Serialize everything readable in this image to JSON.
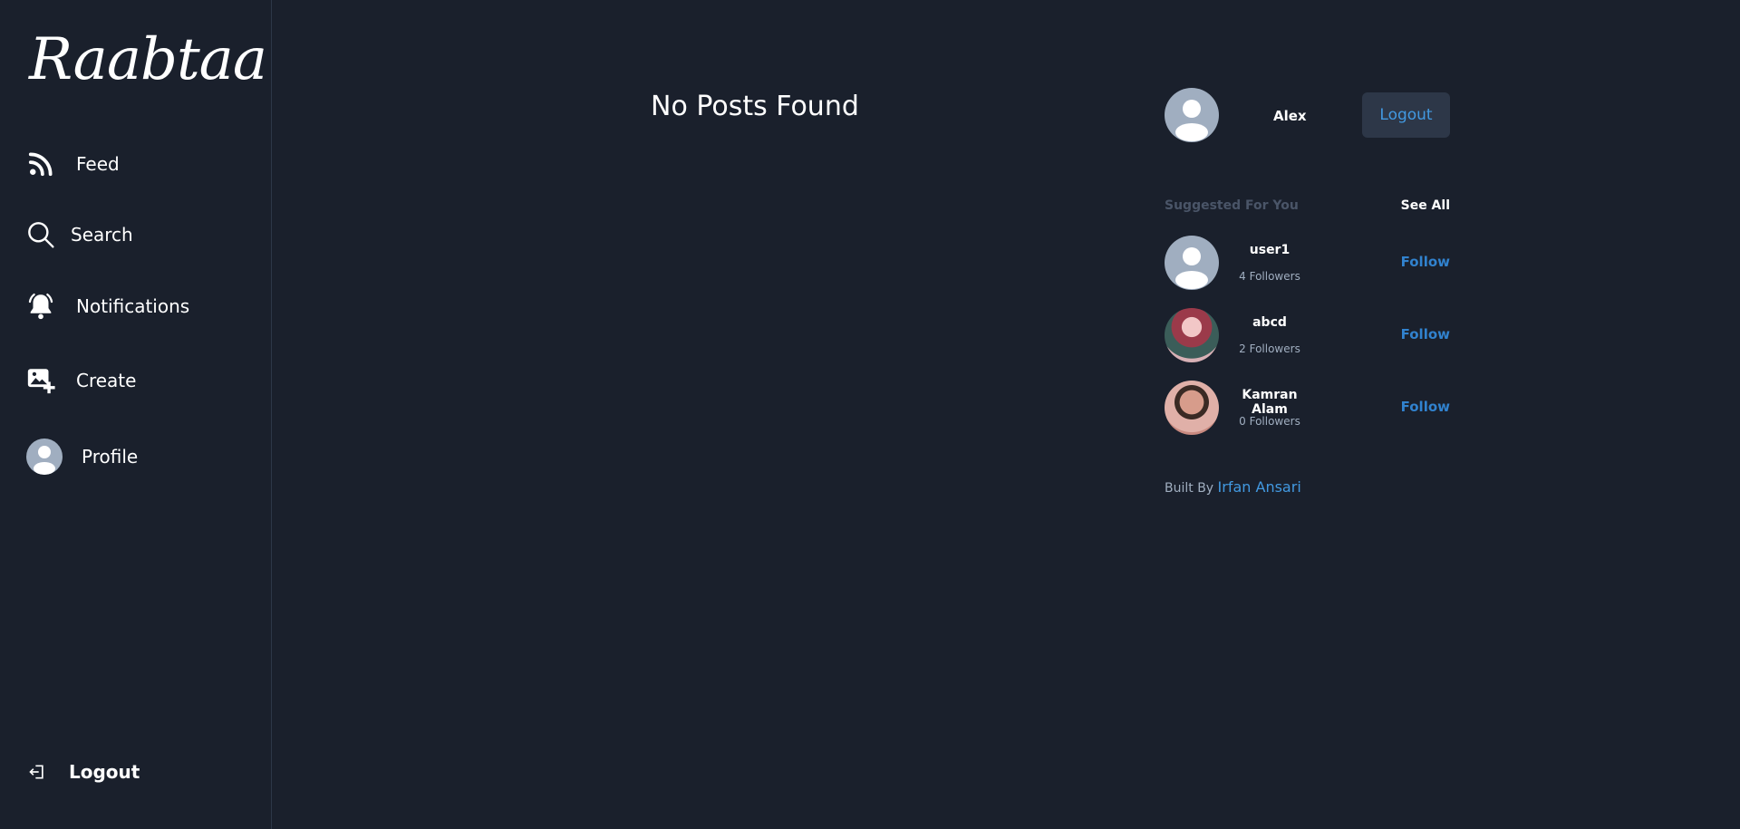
{
  "sidebar": {
    "logo": "Raabtaa",
    "items": [
      {
        "label": "Feed",
        "icon": "rss-icon"
      },
      {
        "label": "Search",
        "icon": "search-icon"
      },
      {
        "label": "Notifications",
        "icon": "bell-icon"
      },
      {
        "label": "Create",
        "icon": "add-image-icon"
      },
      {
        "label": "Profile",
        "icon": "avatar"
      }
    ],
    "logout_label": "Logout"
  },
  "main": {
    "empty_message": "No Posts Found"
  },
  "right_panel": {
    "current_user": {
      "name": "Alex",
      "logout_label": "Logout"
    },
    "suggested_title": "Suggested For You",
    "see_all_label": "See All",
    "suggestions": [
      {
        "name": "user1",
        "followers": "4 Followers",
        "follow_label": "Follow"
      },
      {
        "name": "abcd",
        "followers": "2 Followers",
        "follow_label": "Follow"
      },
      {
        "name": "Kamran Alam",
        "followers": "0 Followers",
        "follow_label": "Follow"
      }
    ],
    "footer": {
      "prefix": "Built By",
      "author": "Irfan Ansari"
    }
  },
  "colors": {
    "background": "#1a202c",
    "accent": "#4299e1",
    "button_bg": "#2d3748",
    "muted": "#a0aec0",
    "heading_muted": "#4a5568"
  }
}
